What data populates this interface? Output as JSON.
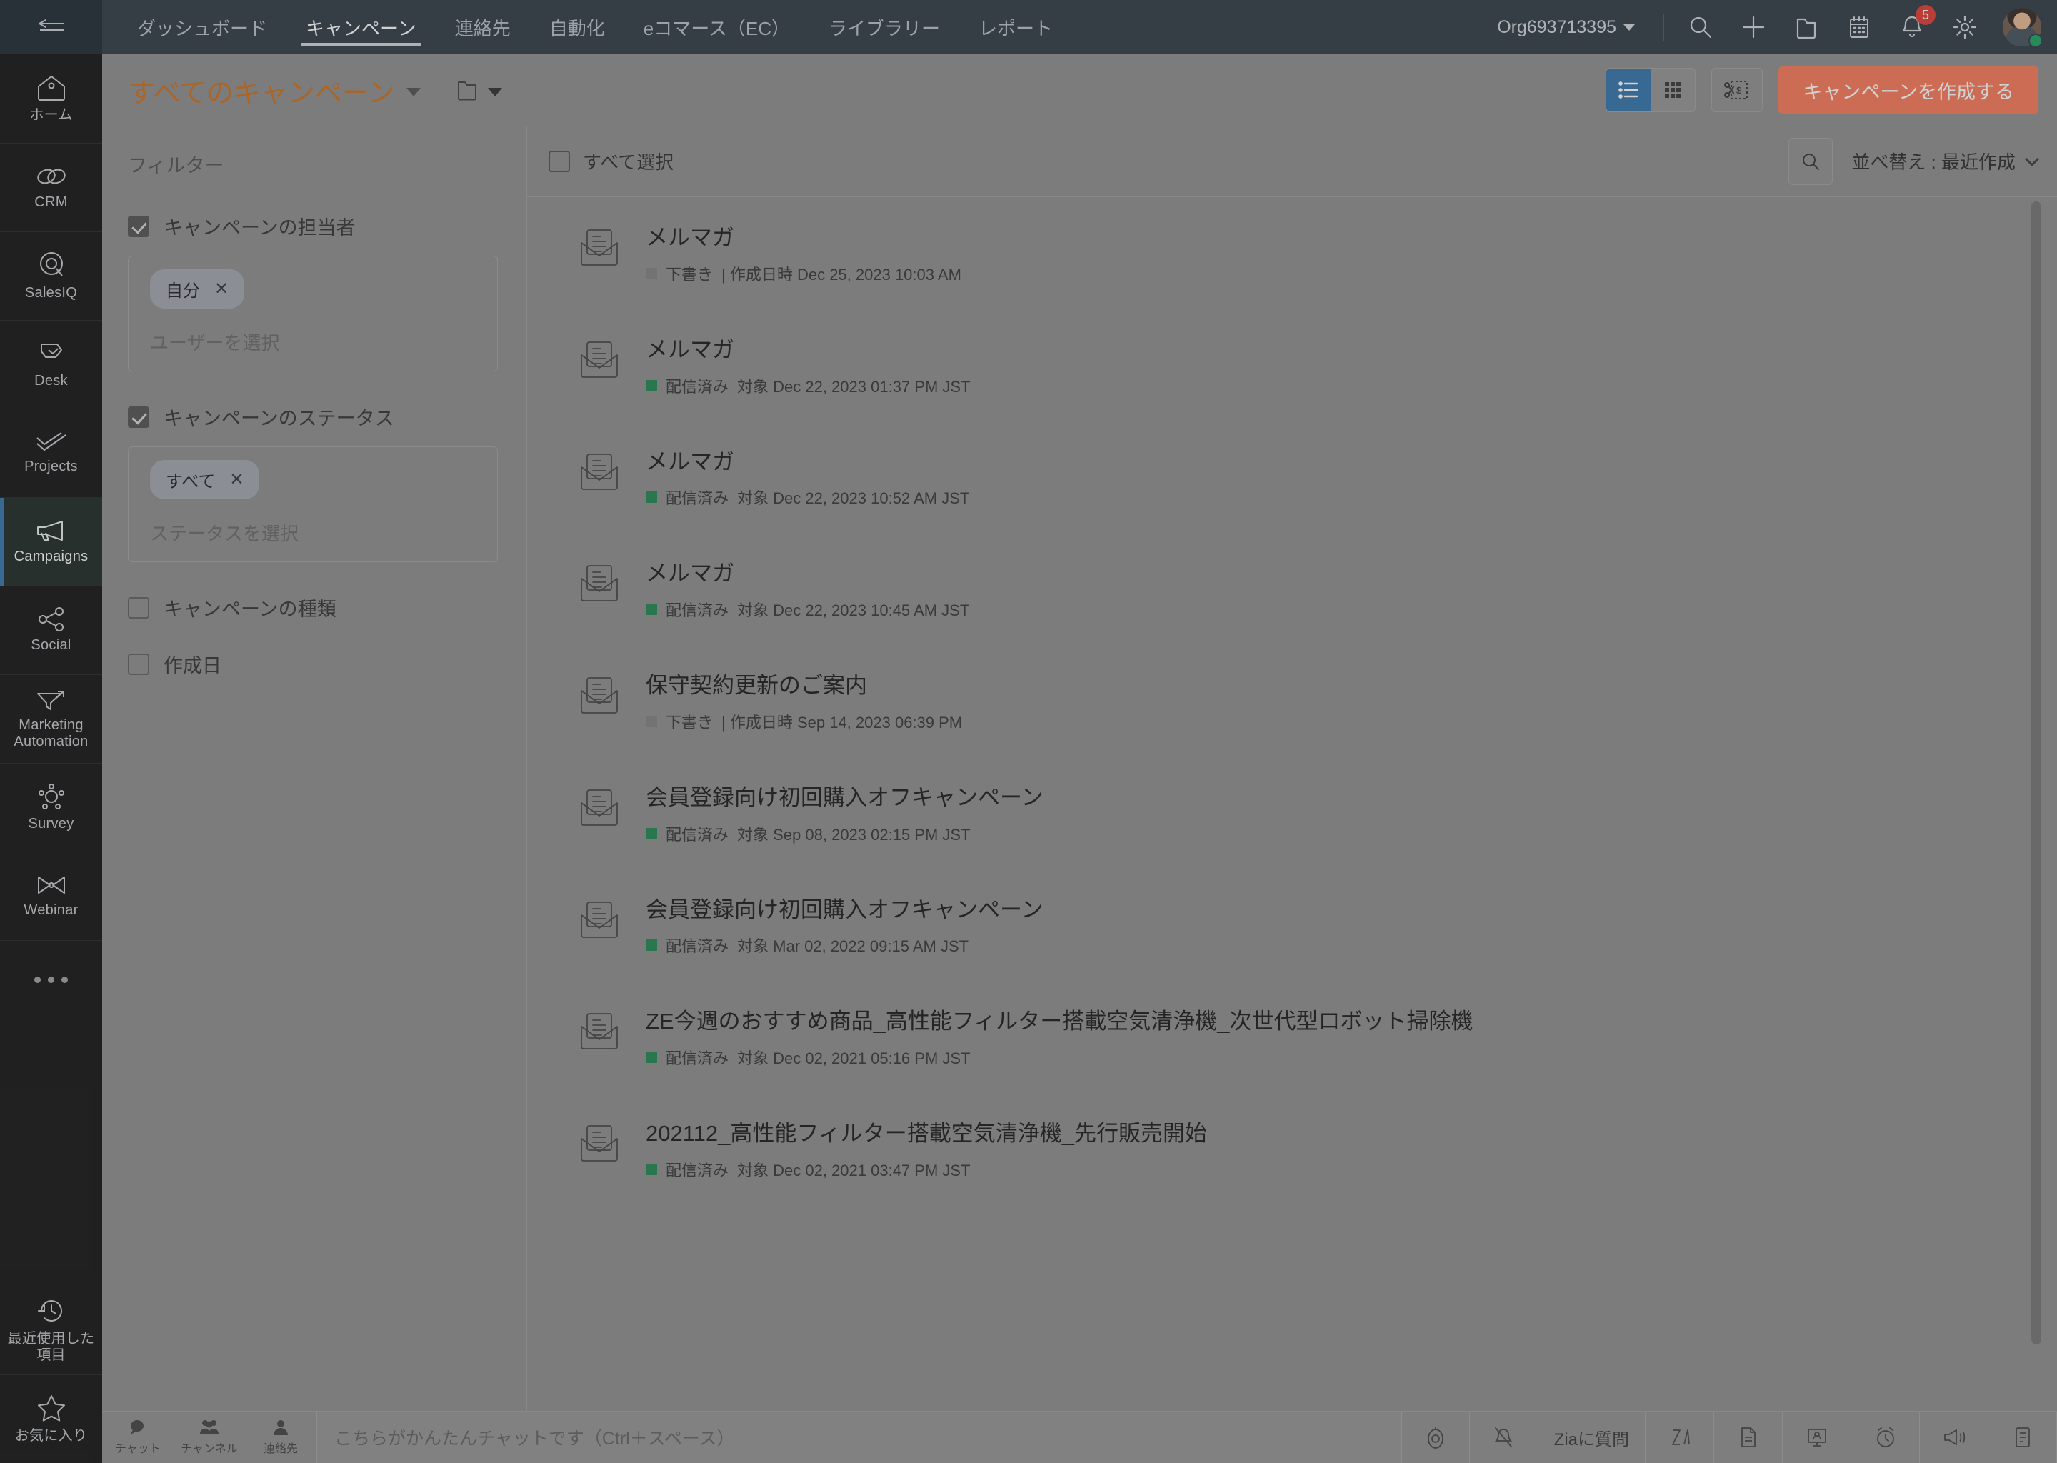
{
  "app_rail": {
    "collapse_icon": "collapse-arrow-icon",
    "items": [
      {
        "label": "ホーム",
        "icon": "home-icon",
        "active": false
      },
      {
        "label": "CRM",
        "icon": "crm-link-icon",
        "active": false
      },
      {
        "label": "SalesIQ",
        "icon": "salesiq-icon",
        "active": false
      },
      {
        "label": "Desk",
        "icon": "desk-icon",
        "active": false
      },
      {
        "label": "Projects",
        "icon": "projects-check-icon",
        "active": false
      },
      {
        "label": "Campaigns",
        "icon": "campaigns-megaphone-icon",
        "active": true
      },
      {
        "label": "Social",
        "icon": "social-share-icon",
        "active": false
      },
      {
        "label": "Marketing Automation",
        "icon": "marketing-automation-funnel-icon",
        "active": false
      },
      {
        "label": "Survey",
        "icon": "survey-icon",
        "active": false
      },
      {
        "label": "Webinar",
        "icon": "webinar-icon",
        "active": false
      }
    ],
    "more_label": "•••",
    "bottom_items": [
      {
        "label": "最近使用した項目",
        "icon": "history-clock-icon"
      },
      {
        "label": "お気に入り",
        "icon": "star-icon"
      }
    ]
  },
  "topnav": {
    "tabs": [
      {
        "label": "ダッシュボード",
        "active": false
      },
      {
        "label": "キャンペーン",
        "active": true
      },
      {
        "label": "連絡先",
        "active": false
      },
      {
        "label": "自動化",
        "active": false
      },
      {
        "label": "eコマース（EC）",
        "active": false
      },
      {
        "label": "ライブラリー",
        "active": false
      },
      {
        "label": "レポート",
        "active": false
      }
    ],
    "org_name": "Org693713395",
    "icons": [
      {
        "name": "search-icon"
      },
      {
        "name": "add-plus-icon"
      },
      {
        "name": "folder-icon"
      },
      {
        "name": "calendar-icon"
      },
      {
        "name": "notifications-bell-icon",
        "badge": "5"
      },
      {
        "name": "settings-gear-icon"
      }
    ],
    "avatar_name": "user-avatar"
  },
  "pagehead": {
    "title": "すべてのキャンペーン",
    "folder_icon": "folder-icon",
    "view_list_icon": "list-view-icon",
    "view_grid_icon": "grid-view-icon",
    "coupon_icon": "coupon-scissors-icon",
    "create_label": "キャンペーンを作成する",
    "accent_color": "#fa7352",
    "title_color": "#c96a17"
  },
  "filters": {
    "title": "フィルター",
    "groups": [
      {
        "label": "キャンペーンの担当者",
        "checked": true,
        "has_box": true,
        "chips": [
          "自分"
        ],
        "placeholder": "ユーザーを選択"
      },
      {
        "label": "キャンペーンのステータス",
        "checked": true,
        "has_box": true,
        "chips": [
          "すべて"
        ],
        "placeholder": "ステータスを選択"
      },
      {
        "label": "キャンペーンの種類",
        "checked": false,
        "has_box": false
      },
      {
        "label": "作成日",
        "checked": false,
        "has_box": false
      }
    ]
  },
  "list": {
    "select_all_label": "すべて選択",
    "search_icon": "search-icon",
    "sort_label": "並べ替え : 最近作成",
    "status_colors": {
      "draft": "#7d7d7d",
      "sent": "#18824c"
    },
    "rows": [
      {
        "title": "メルマガ",
        "status": "下書き",
        "status_type": "draft",
        "meta": "| 作成日時 Dec 25, 2023 10:03 AM"
      },
      {
        "title": "メルマガ",
        "status": "配信済み",
        "status_type": "sent",
        "meta": "対象 Dec 22, 2023 01:37 PM JST"
      },
      {
        "title": "メルマガ",
        "status": "配信済み",
        "status_type": "sent",
        "meta": "対象 Dec 22, 2023 10:52 AM JST"
      },
      {
        "title": "メルマガ",
        "status": "配信済み",
        "status_type": "sent",
        "meta": "対象 Dec 22, 2023 10:45 AM JST"
      },
      {
        "title": "保守契約更新のご案内",
        "status": "下書き",
        "status_type": "draft",
        "meta": "| 作成日時 Sep 14, 2023 06:39 PM"
      },
      {
        "title": "会員登録向け初回購入オフキャンペーン",
        "status": "配信済み",
        "status_type": "sent",
        "meta": "対象 Sep 08, 2023 02:15 PM JST"
      },
      {
        "title": "会員登録向け初回購入オフキャンペーン",
        "status": "配信済み",
        "status_type": "sent",
        "meta": "対象 Mar 02, 2022 09:15 AM JST"
      },
      {
        "title": "ZE今週のおすすめ商品_高性能フィルター搭載空気清浄機_次世代型ロボット掃除機",
        "status": "配信済み",
        "status_type": "sent",
        "meta": "対象 Dec 02, 2021 05:16 PM JST"
      },
      {
        "title": "202112_高性能フィルター搭載空気清浄機_先行販売開始",
        "status": "配信済み",
        "status_type": "sent",
        "meta": "対象 Dec 02, 2021 03:47 PM JST"
      }
    ]
  },
  "bottombar": {
    "tabs": [
      {
        "label": "チャット",
        "icon": "chat-bubble-icon"
      },
      {
        "label": "チャンネル",
        "icon": "channels-group-icon"
      },
      {
        "label": "連絡先",
        "icon": "contact-person-icon"
      }
    ],
    "input_placeholder": "こちらがかんたんチャットです（Ctrl＋スペース）",
    "zia_label": "Ziaに質問",
    "right_icons": [
      {
        "name": "zia-orb-icon"
      },
      {
        "name": "do-not-disturb-icon"
      },
      {
        "name": "zia-glyph-icon"
      },
      {
        "name": "document-icon"
      },
      {
        "name": "presentation-icon"
      },
      {
        "name": "reminder-clock-icon"
      },
      {
        "name": "announcement-megaphone-icon"
      },
      {
        "name": "notes-clipboard-icon"
      }
    ]
  }
}
